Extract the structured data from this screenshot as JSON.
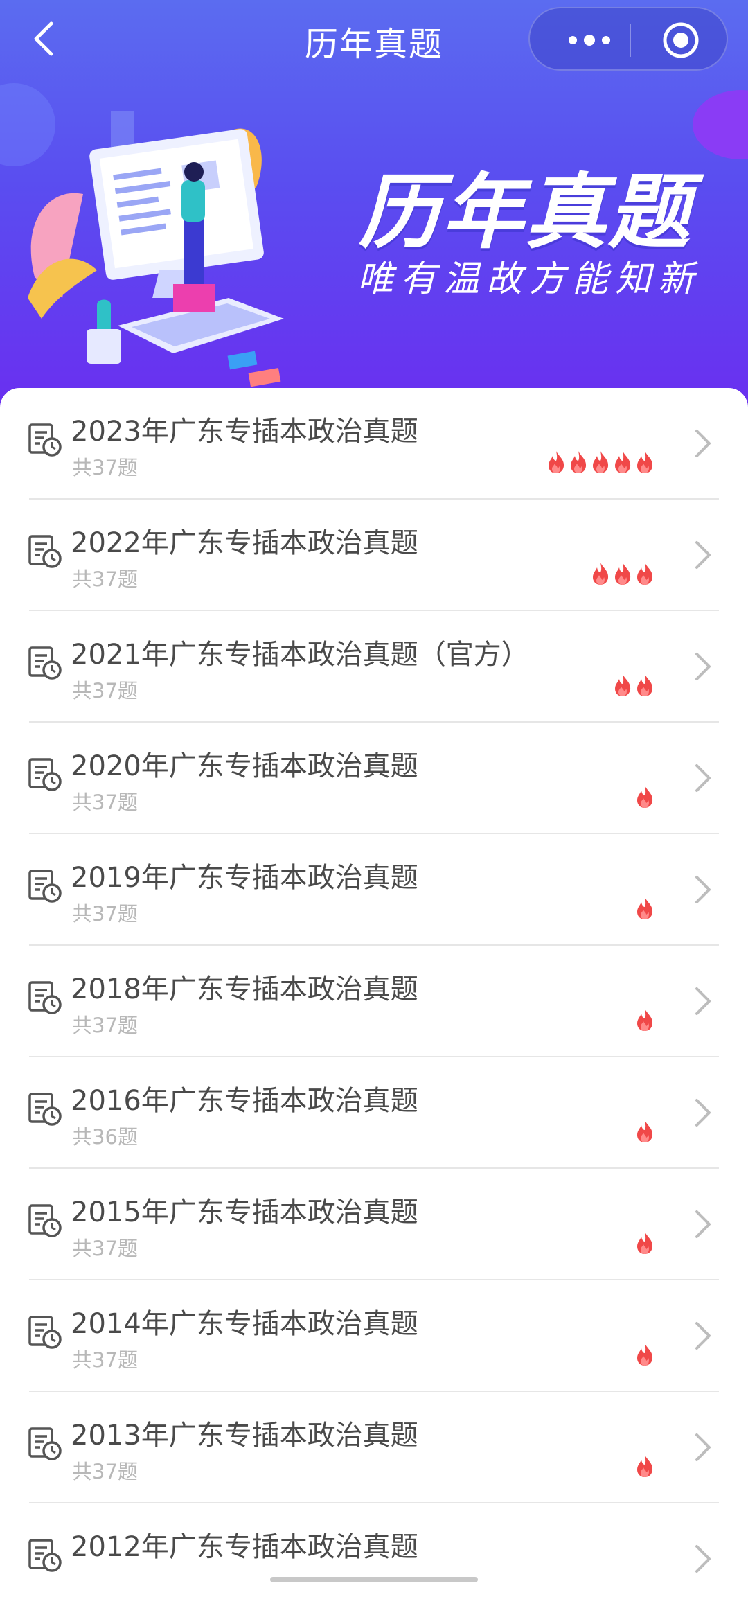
{
  "nav": {
    "title": "历年真题",
    "back_icon": "chevron-left-icon",
    "more_icon": "more-dots-icon",
    "close_icon": "target-circle-icon"
  },
  "hero": {
    "title": "历年真题",
    "subtitle": "唯有温故方能知新"
  },
  "colors": {
    "hero_top": "#5b6cf0",
    "hero_bottom": "#6a2ff0",
    "flame": "#f04848",
    "title_text": "#4a4a4a",
    "count_text": "#b8b8b8"
  },
  "list": [
    {
      "title": "2023年广东专插本政治真题",
      "count": "共37题",
      "hot": 5
    },
    {
      "title": "2022年广东专插本政治真题",
      "count": "共37题",
      "hot": 3
    },
    {
      "title": "2021年广东专插本政治真题（官方）",
      "count": "共37题",
      "hot": 2
    },
    {
      "title": "2020年广东专插本政治真题",
      "count": "共37题",
      "hot": 1
    },
    {
      "title": "2019年广东专插本政治真题",
      "count": "共37题",
      "hot": 1
    },
    {
      "title": "2018年广东专插本政治真题",
      "count": "共37题",
      "hot": 1
    },
    {
      "title": "2016年广东专插本政治真题",
      "count": "共36题",
      "hot": 1
    },
    {
      "title": "2015年广东专插本政治真题",
      "count": "共37题",
      "hot": 1
    },
    {
      "title": "2014年广东专插本政治真题",
      "count": "共37题",
      "hot": 1
    },
    {
      "title": "2013年广东专插本政治真题",
      "count": "共37题",
      "hot": 1
    },
    {
      "title": "2012年广东专插本政治真题",
      "count": "",
      "hot": 0
    }
  ]
}
